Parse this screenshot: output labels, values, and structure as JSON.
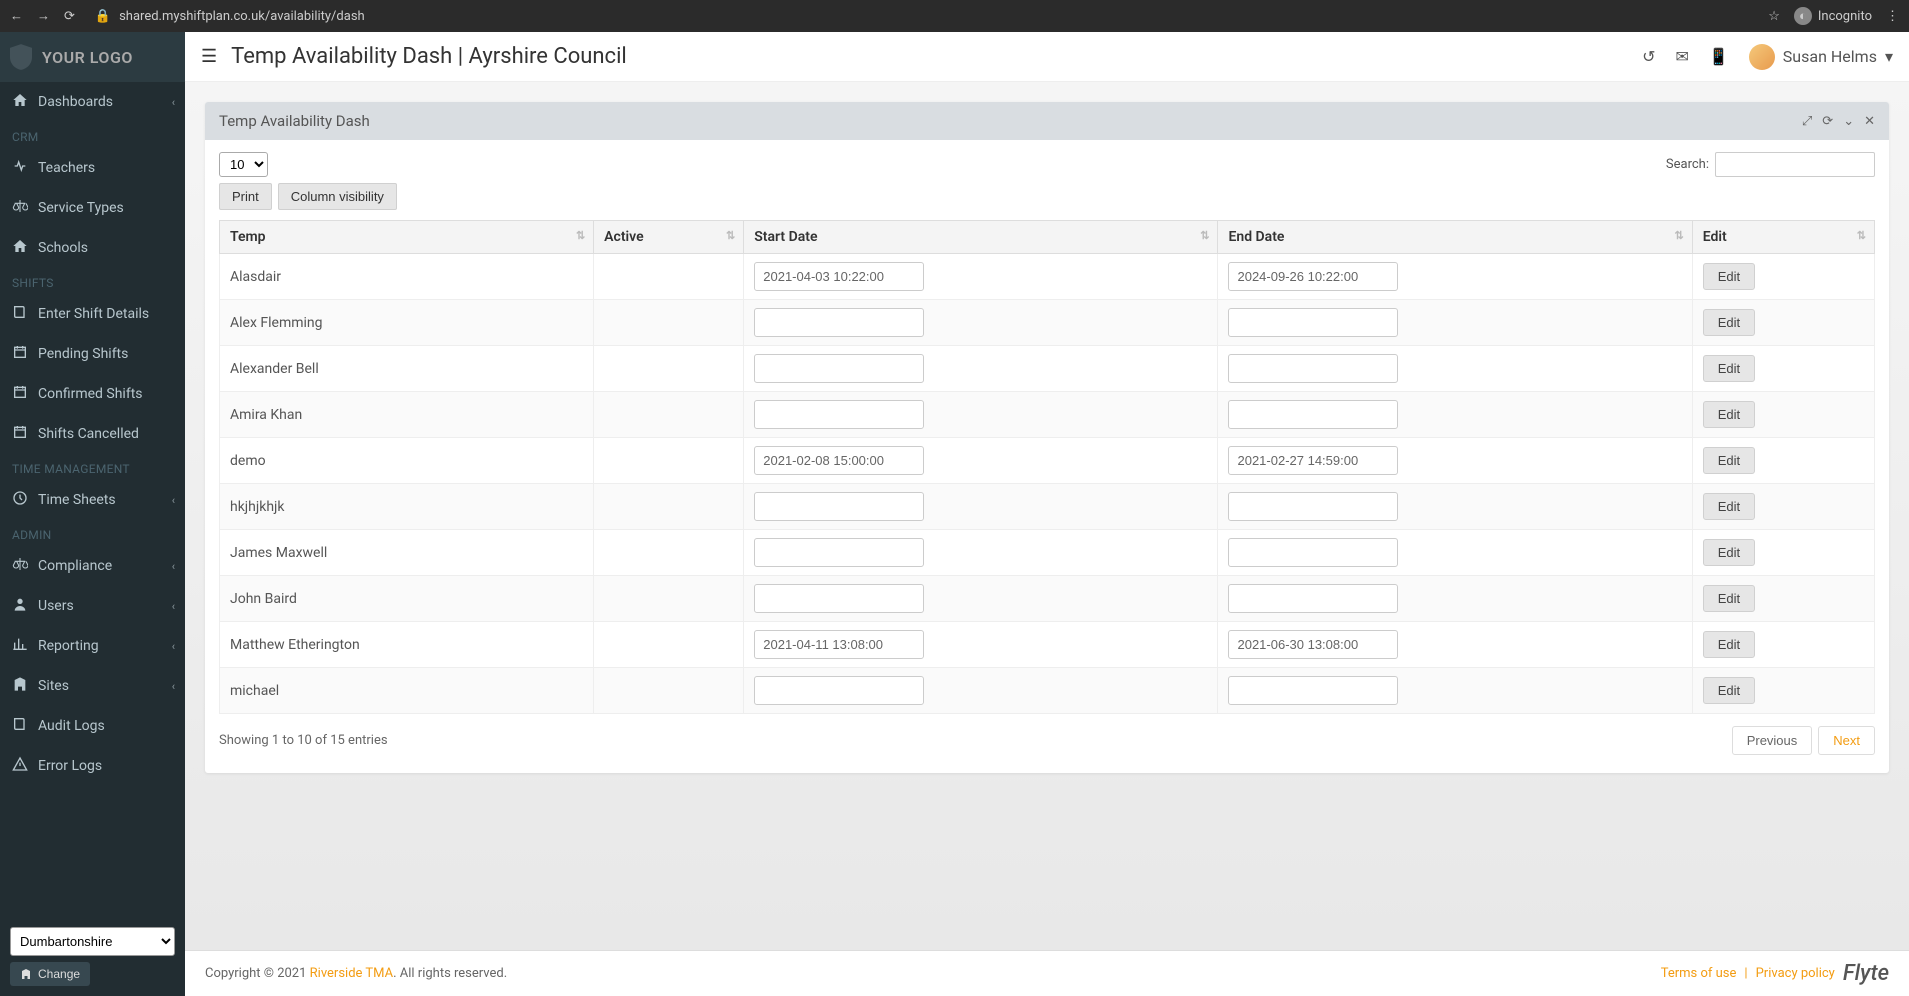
{
  "browser": {
    "url": "shared.myshiftplan.co.uk/availability/dash",
    "incognito_label": "Incognito"
  },
  "sidebar": {
    "logo_text": "YOUR LOGO",
    "items": [
      {
        "label": "Dashboards",
        "icon": "home",
        "expandable": true
      }
    ],
    "section_crm": "CRM",
    "crm_items": [
      {
        "label": "Teachers",
        "icon": "health"
      },
      {
        "label": "Service Types",
        "icon": "balance"
      },
      {
        "label": "Schools",
        "icon": "home"
      }
    ],
    "section_shifts": "SHIFTS",
    "shift_items": [
      {
        "label": "Enter Shift Details",
        "icon": "book"
      },
      {
        "label": "Pending Shifts",
        "icon": "calendar"
      },
      {
        "label": "Confirmed Shifts",
        "icon": "calendar"
      },
      {
        "label": "Shifts Cancelled",
        "icon": "calendar"
      }
    ],
    "section_time": "TIME MANAGEMENT",
    "time_items": [
      {
        "label": "Time Sheets",
        "icon": "clock",
        "expandable": true
      }
    ],
    "section_admin": "ADMIN",
    "admin_items": [
      {
        "label": "Compliance",
        "icon": "balance",
        "expandable": true
      },
      {
        "label": "Users",
        "icon": "user",
        "expandable": true
      },
      {
        "label": "Reporting",
        "icon": "chart",
        "expandable": true
      },
      {
        "label": "Sites",
        "icon": "building",
        "expandable": true
      },
      {
        "label": "Audit Logs",
        "icon": "book"
      },
      {
        "label": "Error Logs",
        "icon": "warning"
      }
    ],
    "region_selected": "Dumbartonshire",
    "change_label": "Change"
  },
  "header": {
    "title": "Temp Availability Dash | Ayrshire Council",
    "user_name": "Susan Helms"
  },
  "panel": {
    "title": "Temp Availability Dash"
  },
  "table": {
    "page_size": "10",
    "search_label": "Search:",
    "print_label": "Print",
    "colvis_label": "Column visibility",
    "columns": [
      "Temp",
      "Active",
      "Start Date",
      "End Date",
      "Edit"
    ],
    "rows": [
      {
        "temp": "Alasdair",
        "active": "",
        "start": "2021-04-03 10:22:00",
        "end": "2024-09-26 10:22:00"
      },
      {
        "temp": "Alex Flemming",
        "active": "",
        "start": "",
        "end": ""
      },
      {
        "temp": "Alexander Bell",
        "active": "",
        "start": "",
        "end": ""
      },
      {
        "temp": "Amira Khan",
        "active": "",
        "start": "",
        "end": ""
      },
      {
        "temp": "demo",
        "active": "",
        "start": "2021-02-08 15:00:00",
        "end": "2021-02-27 14:59:00"
      },
      {
        "temp": "hkjhjkhjk",
        "active": "",
        "start": "",
        "end": ""
      },
      {
        "temp": "James Maxwell",
        "active": "",
        "start": "",
        "end": ""
      },
      {
        "temp": "John Baird",
        "active": "",
        "start": "",
        "end": ""
      },
      {
        "temp": "Matthew Etherington",
        "active": "",
        "start": "2021-04-11 13:08:00",
        "end": "2021-06-30 13:08:00"
      },
      {
        "temp": "michael",
        "active": "",
        "start": "",
        "end": ""
      }
    ],
    "edit_label": "Edit",
    "info": "Showing 1 to 10 of 15 entries",
    "prev_label": "Previous",
    "next_label": "Next"
  },
  "footer": {
    "copyright_prefix": "Copyright © 2021 ",
    "company": "Riverside TMA",
    "copyright_suffix": ". All rights reserved.",
    "terms": "Terms of use",
    "privacy": "Privacy policy",
    "brand": "Flyte"
  }
}
